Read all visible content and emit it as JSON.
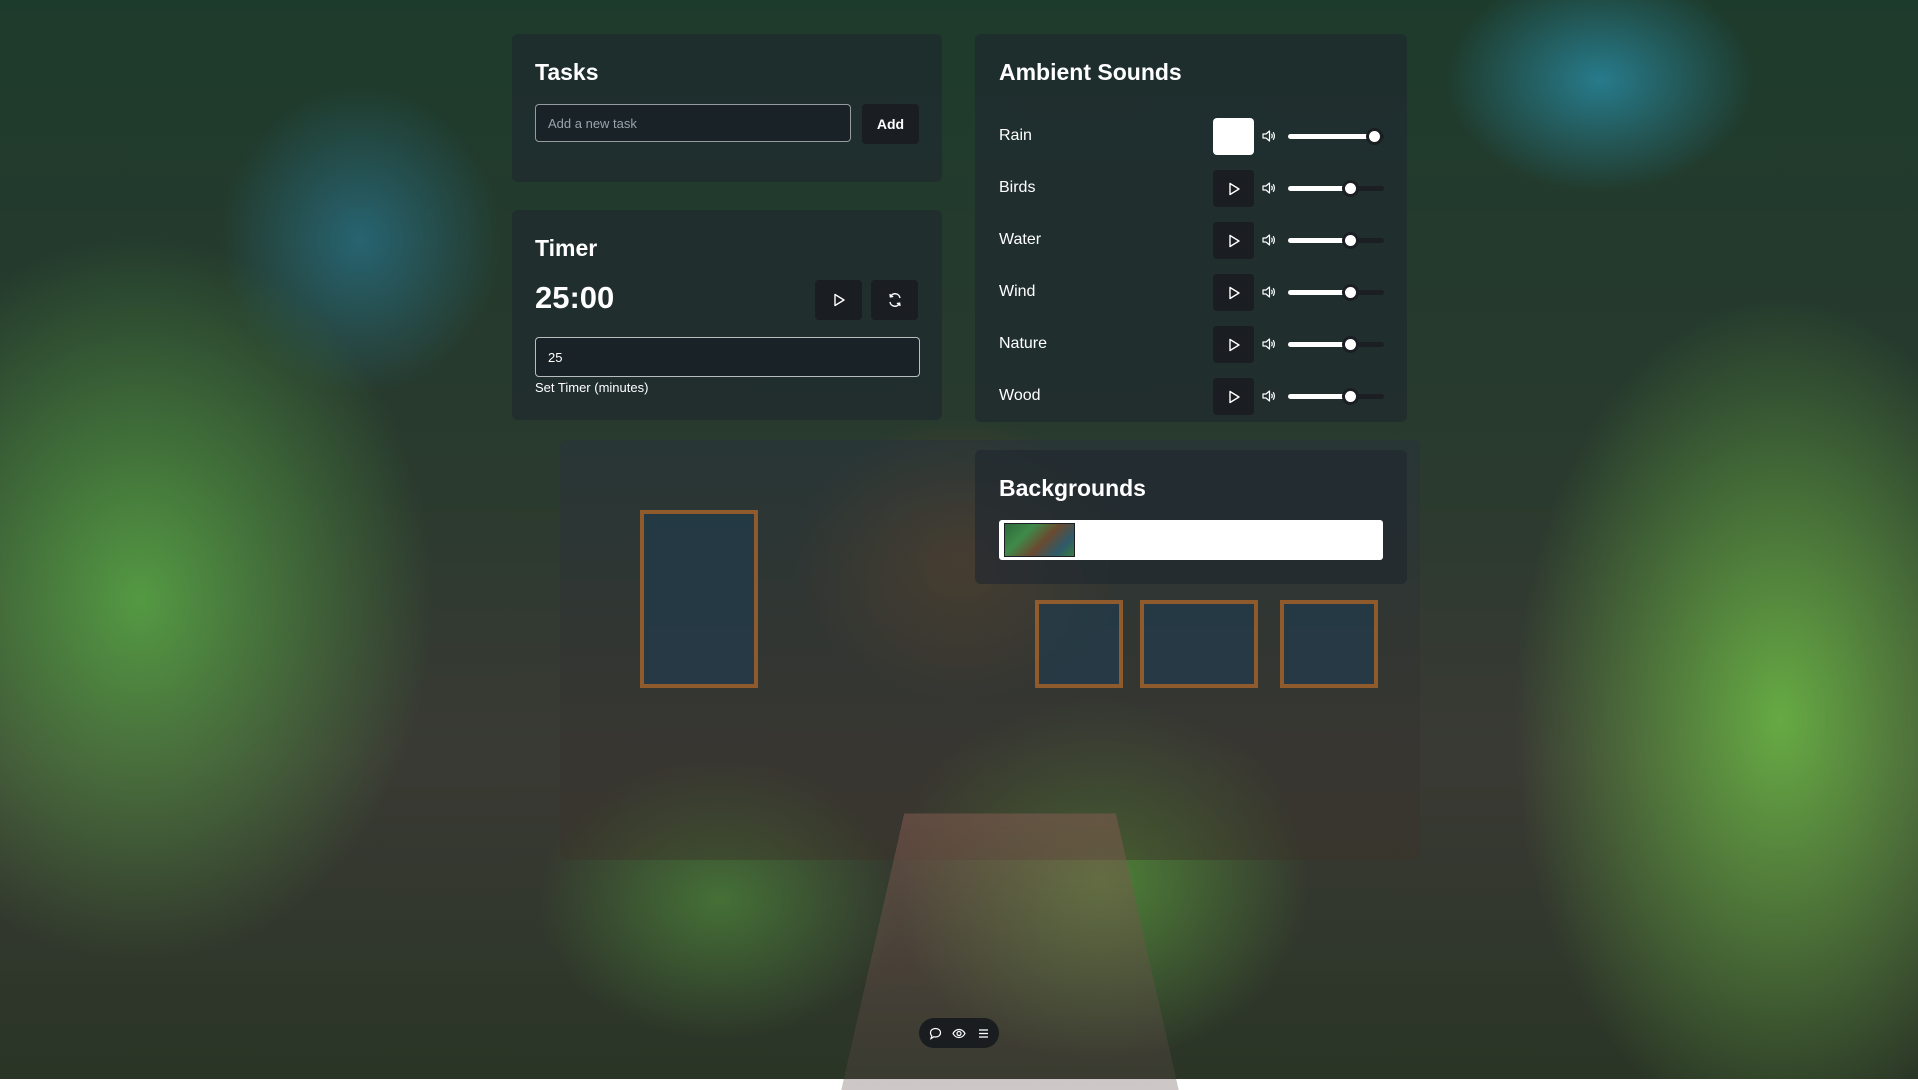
{
  "tasks": {
    "title": "Tasks",
    "input_placeholder": "Add a new task",
    "add_label": "Add"
  },
  "timer": {
    "title": "Timer",
    "display": "25:00",
    "input_value": "25",
    "input_label": "Set Timer (minutes)",
    "play_icon": "play-icon",
    "reset_icon": "reset-icon"
  },
  "ambient": {
    "title": "Ambient Sounds",
    "sounds": [
      {
        "label": "Rain",
        "playing": true,
        "volume": 0.9
      },
      {
        "label": "Birds",
        "playing": false,
        "volume": 0.65
      },
      {
        "label": "Water",
        "playing": false,
        "volume": 0.65
      },
      {
        "label": "Wind",
        "playing": false,
        "volume": 0.65
      },
      {
        "label": "Nature",
        "playing": false,
        "volume": 0.65
      },
      {
        "label": "Wood",
        "playing": false,
        "volume": 0.65
      }
    ]
  },
  "backgrounds": {
    "title": "Backgrounds"
  },
  "toolbar": {
    "icons": [
      "chat-icon",
      "eye-icon",
      "menu-icon"
    ]
  },
  "colors": {
    "panel_bg": "#1e262e",
    "button_dark": "#1a1d22",
    "accent_white": "#ffffff"
  }
}
